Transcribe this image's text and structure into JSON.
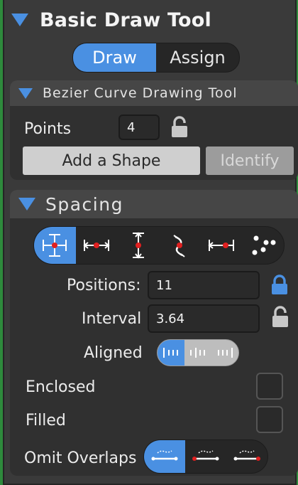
{
  "header": {
    "title": "Basic Draw Tool",
    "collapse_icon": "triangle-down-icon"
  },
  "mode_tabs": [
    {
      "label": "Draw",
      "active": true
    },
    {
      "label": "Assign",
      "active": false
    }
  ],
  "bezier_section": {
    "title": "Bezier Curve Drawing Tool",
    "points_label": "Points",
    "points_value": "4",
    "points_lock_icon": "unlocked-padlock-icon",
    "add_shape_label": "Add a Shape",
    "identify_label": "Identify"
  },
  "spacing_section": {
    "title": "Spacing",
    "mode_icons": [
      "fit-both-icon",
      "horizontal-span-icon",
      "vertical-span-icon",
      "curve-segment-icon",
      "fixed-span-icon",
      "scatter-dots-icon"
    ],
    "active_mode_index": 0,
    "positions_label": "Positions:",
    "positions_value": "11",
    "positions_lock_icon": "locked-padlock-icon",
    "interval_label": "Interval",
    "interval_value": "3.64",
    "interval_lock_icon": "unlocked-padlock-icon",
    "aligned_label": "Aligned",
    "aligned_options": [
      "align-start-icon",
      "align-center-icon",
      "align-end-icon"
    ],
    "aligned_active_index": 0,
    "enclosed_label": "Enclosed",
    "enclosed_checked": false,
    "filled_label": "Filled",
    "filled_checked": false,
    "omit_overlaps_label": "Omit Overlaps",
    "omit_overlaps_options": [
      "omit-none-icon",
      "omit-start-icon",
      "omit-end-icon"
    ],
    "omit_overlaps_active_index": 0
  },
  "colors": {
    "accent": "#4a90e2",
    "panel": "#3a3a3a",
    "section": "#303030",
    "marker": "#e02020"
  }
}
